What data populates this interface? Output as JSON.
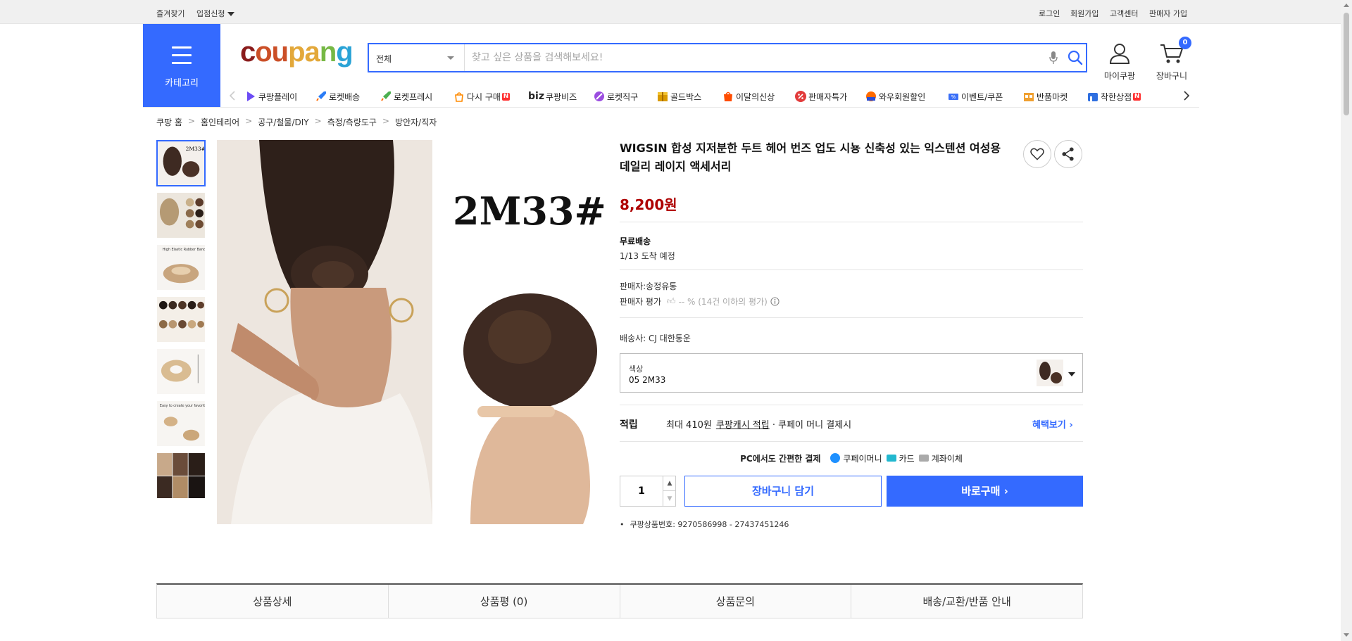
{
  "topbar": {
    "bookmark": "즐겨찾기",
    "partner_apply": "입점신청",
    "login": "로그인",
    "signup": "회원가입",
    "customer_center": "고객센터",
    "seller_signup": "판매자 가입"
  },
  "header": {
    "category_label": "카테고리",
    "logo": {
      "c1": "c",
      "c2": "ou",
      "c3": "pa",
      "c4": "n",
      "c5": "g"
    },
    "search_scope": "전체",
    "search_placeholder": "찾고 싶은 상품을 검색해보세요!",
    "my_coupang": "마이쿠팡",
    "cart_label": "장바구니",
    "cart_count": "0"
  },
  "category_nav": [
    {
      "label": "쿠팡플레이",
      "icon": "play-icon",
      "color": "#6c4cf5"
    },
    {
      "label": "로켓배송",
      "icon": "rocket-icon",
      "color": "#2a7cf6"
    },
    {
      "label": "로켓프레시",
      "icon": "rocket-fresh-icon",
      "color": "#4caf50"
    },
    {
      "label": "다시 구매",
      "icon": "rebuy-icon",
      "color": "#ff8a00",
      "badge": "N"
    },
    {
      "label": "쿠팡비즈",
      "icon": "biz-icon",
      "color": "#222222"
    },
    {
      "label": "로켓직구",
      "icon": "global-icon",
      "color": "#9b4de0"
    },
    {
      "label": "골드박스",
      "icon": "goldbox-icon",
      "color": "#d99a00"
    },
    {
      "label": "이달의신상",
      "icon": "new-icon",
      "color": "#ff4c00"
    },
    {
      "label": "판매자특가",
      "icon": "percent-icon",
      "color": "#e23b3b"
    },
    {
      "label": "와우회원할인",
      "icon": "wow-icon",
      "color": "#ff6a00"
    },
    {
      "label": "이벤트/쿠폰",
      "icon": "coupon-icon",
      "color": "#3a6ff7"
    },
    {
      "label": "반품마켓",
      "icon": "return-market-icon",
      "color": "#f0a030"
    },
    {
      "label": "착한상점",
      "icon": "good-shop-icon",
      "color": "#2f6fe0",
      "badge": "N"
    }
  ],
  "breadcrumb": [
    "쿠팡 홈",
    "홈인테리어",
    "공구/철물/DIY",
    "측정/측량도구",
    "방안자/직자"
  ],
  "product": {
    "title": "WIGSIN 합성 지저분한 두트 헤어 번즈 업도 시뇽 신축성 있는 익스텐션 여성용 데일리 레이지 액세서리",
    "price": "8,200원",
    "shipping_title": "무료배송",
    "arrival": "1/13 도착 예정",
    "seller": "판매자:송정유통",
    "seller_rating_label": "판매자 평가",
    "seller_rating_value": "-- % (14건 이하의 평가)",
    "carrier": "배송사:  CJ 대한통운",
    "option_key": "색상",
    "option_value": "05 2M33",
    "image_caption": "2M33#",
    "reward_label": "적립",
    "reward_max": "최대 410원",
    "reward_link": "쿠팡캐시 적립",
    "reward_tail": " · 쿠페이 머니 결제시",
    "benefit_link": "혜택보기",
    "pay_title": "PC에서도 간편한 결제",
    "pay_methods": [
      "쿠페이머니",
      "카드",
      "계좌이체"
    ],
    "quantity": "1",
    "add_to_cart": "장바구니 담기",
    "buy_now": "바로구매",
    "product_number": "쿠팡상품번호: 9270586998 - 27437451246"
  },
  "tabs": [
    "상품상세",
    "상품평 (0)",
    "상품문의",
    "배송/교환/반품 안내"
  ],
  "colors": {
    "accent": "#346aff",
    "price": "#ae0000"
  }
}
